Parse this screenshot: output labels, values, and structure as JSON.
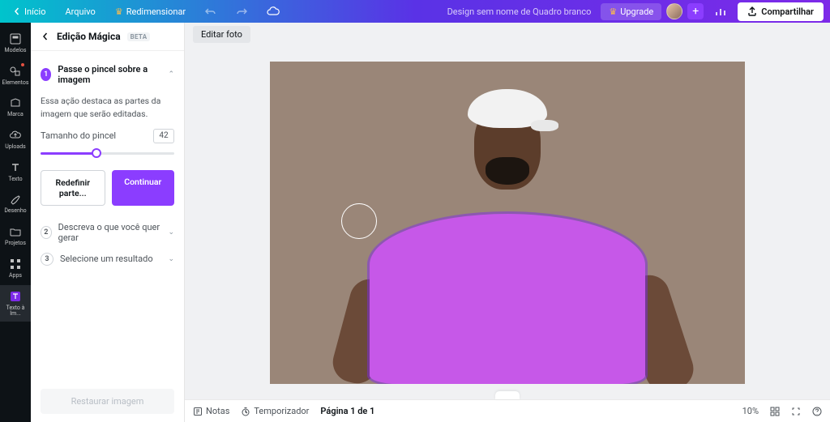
{
  "topbar": {
    "home": "Início",
    "file": "Arquivo",
    "resize": "Redimensionar",
    "doc_name": "Design sem nome de Quadro branco",
    "upgrade": "Upgrade",
    "share": "Compartilhar"
  },
  "sidebar": {
    "items": [
      {
        "label": "Modelos"
      },
      {
        "label": "Elementos"
      },
      {
        "label": "Marca"
      },
      {
        "label": "Uploads"
      },
      {
        "label": "Texto"
      },
      {
        "label": "Desenho"
      },
      {
        "label": "Projetos"
      },
      {
        "label": "Apps"
      },
      {
        "label": "Texto à Im..."
      }
    ]
  },
  "panel": {
    "title": "Edição Mágica",
    "beta": "BETA",
    "steps": [
      {
        "num": "1",
        "label": "Passe o pincel sobre a imagem"
      },
      {
        "num": "2",
        "label": "Descreva o que você quer gerar"
      },
      {
        "num": "3",
        "label": "Selecione um resultado"
      }
    ],
    "desc": "Essa ação destaca as partes da imagem que serão editadas.",
    "brush_label": "Tamanho do pincel",
    "brush_value": "42",
    "reset_btn": "Redefinir parte...",
    "continue_btn": "Continuar",
    "restore_btn": "Restaurar imagem"
  },
  "canvas": {
    "edit_photo": "Editar foto"
  },
  "bottom": {
    "notes": "Notas",
    "timer": "Temporizador",
    "page": "Página 1 de 1",
    "zoom": "10%"
  }
}
